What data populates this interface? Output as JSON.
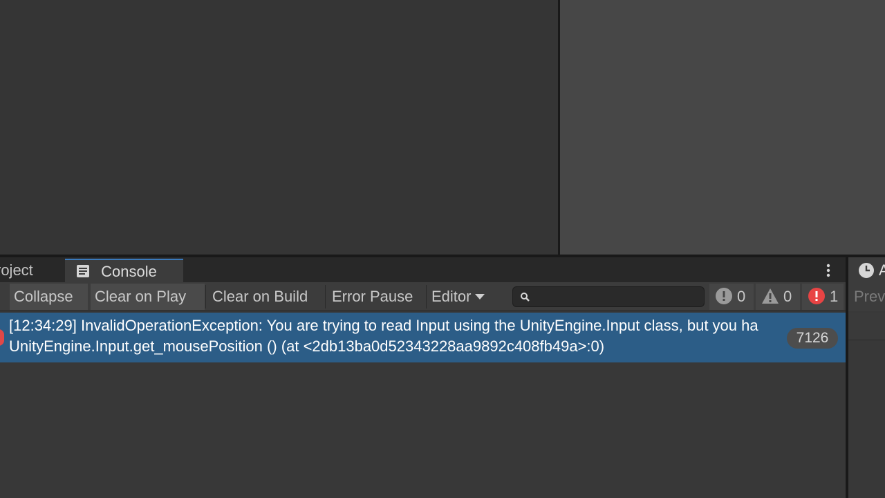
{
  "tabs": {
    "project_label": "roject",
    "console_label": "Console"
  },
  "toolbar": {
    "collapse_label": "Collapse",
    "clear_on_play_label": "Clear on Play",
    "clear_on_build_label": "Clear on Build",
    "error_pause_label": "Error Pause",
    "editor_label": "Editor",
    "search_value": "",
    "info_count": "0",
    "warning_count": "0",
    "error_count": "1"
  },
  "log": {
    "line1": "[12:34:29] InvalidOperationException: You are trying to read Input using the UnityEngine.Input class, but you ha",
    "line2": "UnityEngine.Input.get_mousePosition () (at <2db13ba0d52343228aa9892c408fb49a>:0)",
    "collapse_count": "7126"
  },
  "right_panel": {
    "tab_letter": "A",
    "preview_label": "Prev"
  },
  "colors": {
    "selected_row": "#2c5d87",
    "error_red": "#e04848",
    "tab_accent": "#3a79bb"
  },
  "icons": {
    "console_tab": "console-icon",
    "search": "search-icon",
    "info": "info-icon",
    "warning": "warning-icon",
    "error": "error-icon",
    "right_tab": "clock-icon"
  }
}
